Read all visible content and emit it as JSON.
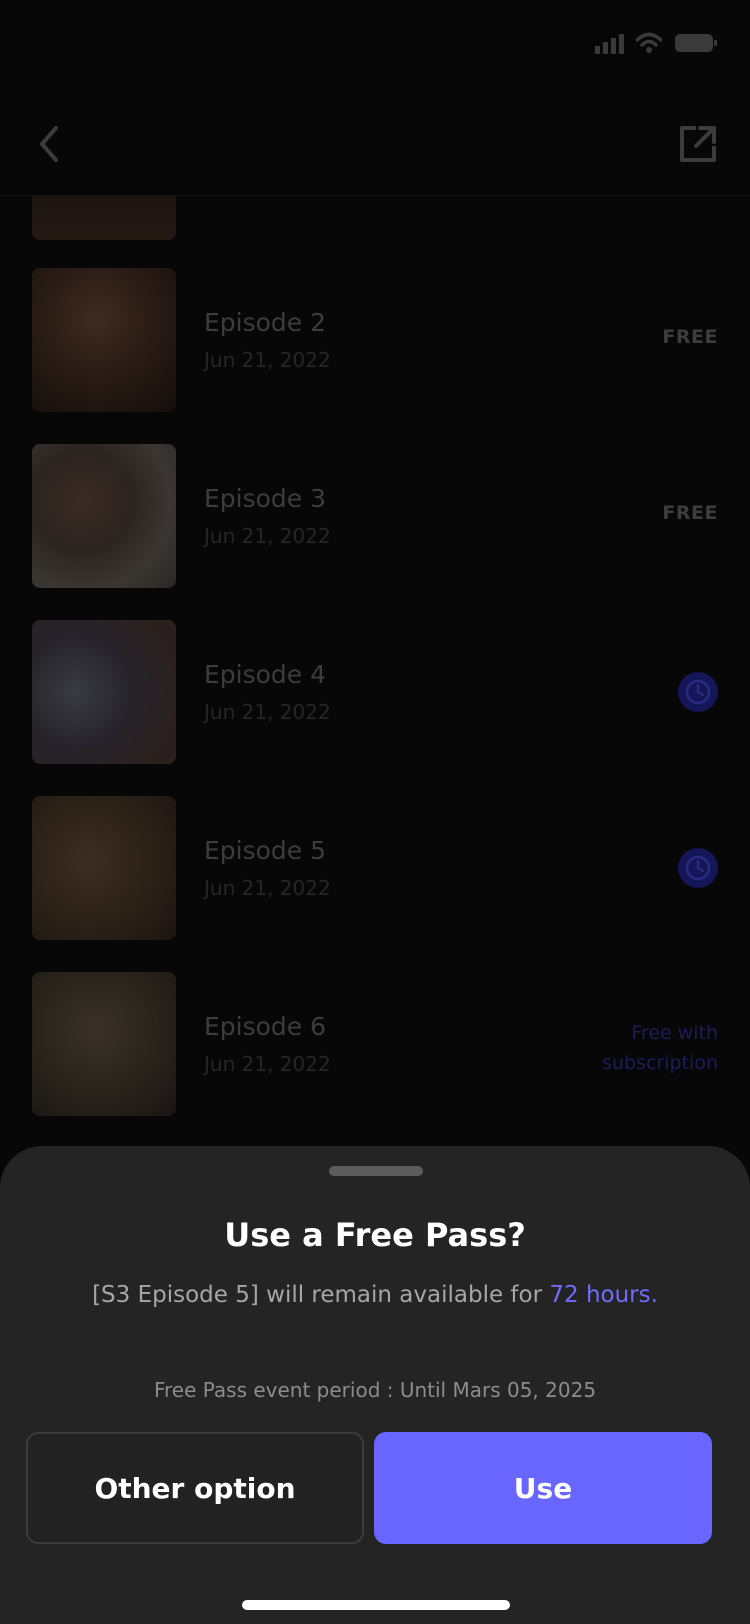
{
  "status_bar": {
    "signal_icon": "signal-bars-icon",
    "wifi_icon": "wifi-icon",
    "battery_icon": "battery-icon"
  },
  "header": {
    "back_icon": "chevron-left-icon",
    "share_icon": "share-external-icon"
  },
  "episodes": [
    {
      "title": "Episode 2",
      "date": "Jun 21, 2022",
      "badge": "FREE",
      "badge_type": "free"
    },
    {
      "title": "Episode 3",
      "date": "Jun 21, 2022",
      "badge": "FREE",
      "badge_type": "free"
    },
    {
      "title": "Episode 4",
      "date": "Jun 21, 2022",
      "badge": "clock-icon",
      "badge_type": "clock"
    },
    {
      "title": "Episode 5",
      "date": "Jun 21, 2022",
      "badge": "clock-icon",
      "badge_type": "clock"
    },
    {
      "title": "Episode 6",
      "date": "Jun 21, 2022",
      "badge": "Free with subscription",
      "badge_type": "subscription",
      "badge_line1": "Free with",
      "badge_line2": "subscription"
    }
  ],
  "sheet": {
    "title": "Use a Free Pass?",
    "message_prefix": "[S3 Episode 5] will remain available for ",
    "message_highlight": "72 hours.",
    "period": "Free Pass event period : Until Mars 05, 2025",
    "other_button": "Other option",
    "use_button": "Use"
  },
  "colors": {
    "accent": "#6966ff",
    "sheet_bg": "#242424",
    "background": "#070707"
  }
}
